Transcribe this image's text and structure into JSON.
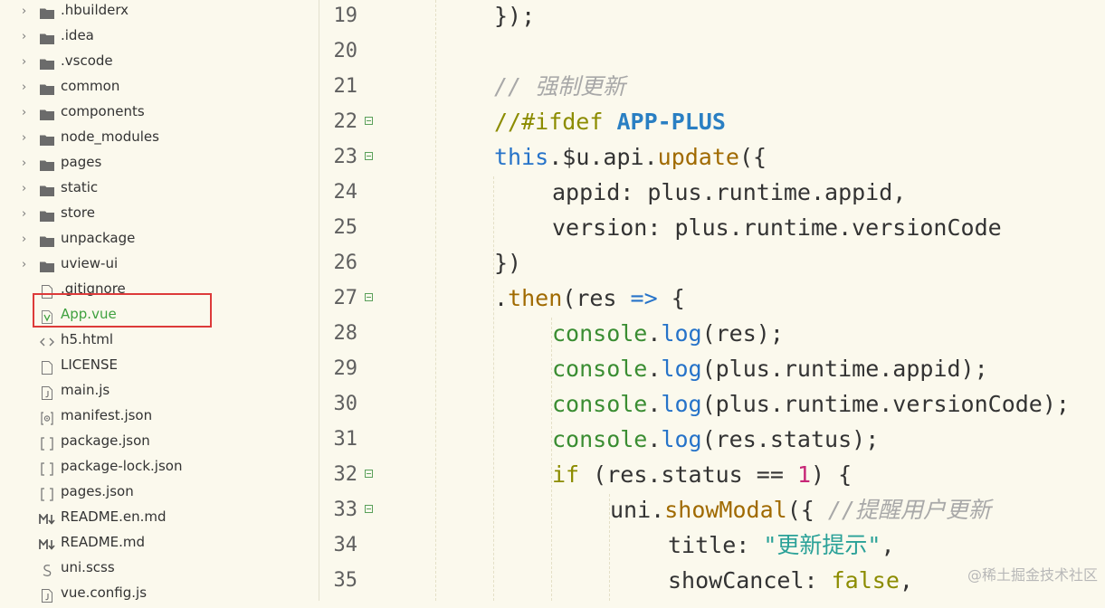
{
  "sidebar": {
    "items": [
      {
        "label": ".hbuilderx",
        "type": "folder"
      },
      {
        "label": ".idea",
        "type": "folder"
      },
      {
        "label": ".vscode",
        "type": "folder"
      },
      {
        "label": "common",
        "type": "folder"
      },
      {
        "label": "components",
        "type": "folder"
      },
      {
        "label": "node_modules",
        "type": "folder"
      },
      {
        "label": "pages",
        "type": "folder"
      },
      {
        "label": "static",
        "type": "folder"
      },
      {
        "label": "store",
        "type": "folder"
      },
      {
        "label": "unpackage",
        "type": "folder"
      },
      {
        "label": "uview-ui",
        "type": "folder"
      },
      {
        "label": ".gitignore",
        "type": "file"
      },
      {
        "label": "App.vue",
        "type": "vue"
      },
      {
        "label": "h5.html",
        "type": "html"
      },
      {
        "label": "LICENSE",
        "type": "file"
      },
      {
        "label": "main.js",
        "type": "js"
      },
      {
        "label": "manifest.json",
        "type": "manifest"
      },
      {
        "label": "package.json",
        "type": "json"
      },
      {
        "label": "package-lock.json",
        "type": "json"
      },
      {
        "label": "pages.json",
        "type": "json"
      },
      {
        "label": "README.en.md",
        "type": "md"
      },
      {
        "label": "README.md",
        "type": "md"
      },
      {
        "label": "uni.scss",
        "type": "scss"
      },
      {
        "label": "vue.config.js",
        "type": "js"
      }
    ],
    "selected": "App.vue"
  },
  "editor": {
    "lines": [
      {
        "n": "19",
        "text": "});"
      },
      {
        "n": "20",
        "text": ""
      },
      {
        "n": "21",
        "text": "// 强制更新"
      },
      {
        "n": "22",
        "text": "//#ifdef APP-PLUS"
      },
      {
        "n": "23",
        "text": "this.$u.api.update({"
      },
      {
        "n": "24",
        "text": "appid: plus.runtime.appid,"
      },
      {
        "n": "25",
        "text": "version: plus.runtime.versionCode"
      },
      {
        "n": "26",
        "text": "})"
      },
      {
        "n": "27",
        "text": ".then(res => {"
      },
      {
        "n": "28",
        "text": "console.log(res);"
      },
      {
        "n": "29",
        "text": "console.log(plus.runtime.appid);"
      },
      {
        "n": "30",
        "text": "console.log(plus.runtime.versionCode);"
      },
      {
        "n": "31",
        "text": "console.log(res.status);"
      },
      {
        "n": "32",
        "text": "if (res.status == 1) {"
      },
      {
        "n": "33",
        "text": "uni.showModal({ //提醒用户更新"
      },
      {
        "n": "34",
        "text": "title: \"更新提示\","
      },
      {
        "n": "35",
        "text": "showCancel: false,"
      }
    ]
  },
  "watermark": "@稀土掘金技术社区",
  "colors": {
    "background": "#fbf9ed",
    "selection_border": "#dd3a3a",
    "active_file": "#3fa13f"
  }
}
